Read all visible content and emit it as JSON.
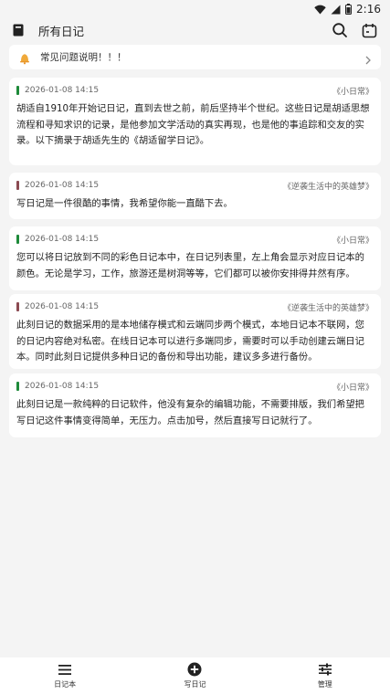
{
  "status_bar": {
    "time": "2:16",
    "icons": [
      "wifi-icon",
      "signal-icon",
      "battery-icon"
    ]
  },
  "header": {
    "title": "所有日记",
    "icons": [
      "notebook-icon",
      "search-icon",
      "calendar-icon"
    ]
  },
  "faq": {
    "label": "常见问题说明！！！",
    "icon": "bell-icon"
  },
  "entries": [
    {
      "date": "2026-01-08 14:15",
      "notebook": "《小日常》",
      "color": "#1e8a3a",
      "text": "胡适自1910年开始记日记，直到去世之前，前后坚持半个世纪。这些日记是胡适思想流程和寻知求识的记录，是他参加文学活动的真实再现，也是他的事追踪和交友的实录。以下摘录于胡适先生的《胡适留学日记》。"
    },
    {
      "date": "2026-01-08 14:15",
      "notebook": "《逆袭生活中的英雄梦》",
      "color": "#8b4a52",
      "text": "写日记是一件很酷的事情，我希望你能一直酷下去。"
    },
    {
      "date": "2026-01-08 14:15",
      "notebook": "《小日常》",
      "color": "#1e8a3a",
      "text": "您可以将日记放到不同的彩色日记本中，在日记列表里，左上角会显示对应日记本的颜色。无论是学习，工作，旅游还是树洞等等，它们都可以被你安排得井然有序。"
    },
    {
      "date": "2026-01-08 14:15",
      "notebook": "《逆袭生活中的英雄梦》",
      "color": "#8b4a52",
      "text": "此刻日记的数据采用的是本地储存模式和云端同步两个模式，本地日记本不联网，您的日记内容绝对私密。在线日记本可以进行多端同步，需要时可以手动创建云端日记本。同时此刻日记提供多种日记的备份和导出功能，建议多多进行备份。"
    },
    {
      "date": "2026-01-08 14:15",
      "notebook": "《小日常》",
      "color": "#1e8a3a",
      "text": "此刻日记是一款纯粹的日记软件，他没有复杂的编辑功能，不需要排版，我们希望把写日记这件事情变得简单，无压力。点击加号，然后直接写日记就行了。"
    }
  ],
  "nav": [
    {
      "label": "日记本",
      "icon": "menu-icon"
    },
    {
      "label": "写日记",
      "icon": "add-circle-icon"
    },
    {
      "label": "管理",
      "icon": "sliders-icon"
    }
  ]
}
